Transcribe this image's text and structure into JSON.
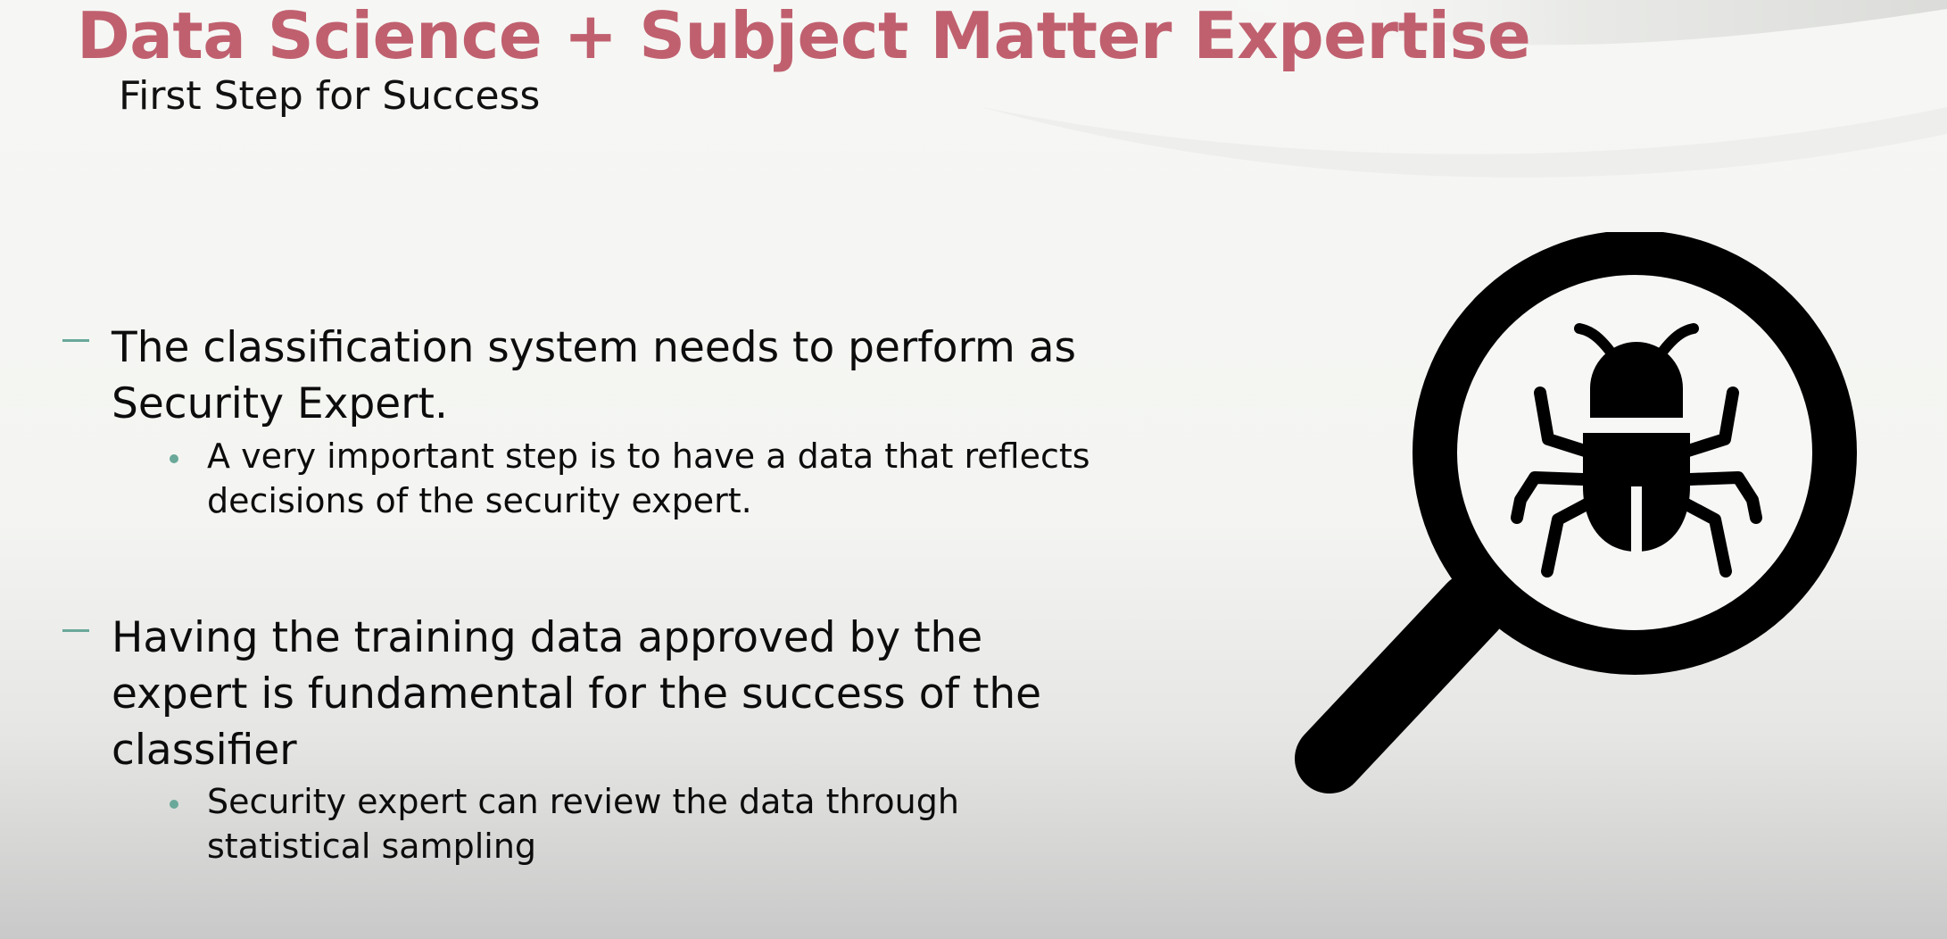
{
  "slide": {
    "title": "Data Science + Subject Matter Expertise",
    "subtitle": "First Step for Success",
    "bullets": [
      {
        "text": "The classification system needs to perform as Security Expert.",
        "sub": "A very important step is to have a data that reflects decisions of the security expert."
      },
      {
        "text": "Having the training data approved by the expert is fundamental for the success of the classifier",
        "sub": "Security expert can review the data through statistical sampling"
      }
    ],
    "icon": "magnifier-bug-icon",
    "colors": {
      "title": "#c0606f",
      "bullet_marker": "#6aa89a",
      "icon": "#000000"
    }
  }
}
